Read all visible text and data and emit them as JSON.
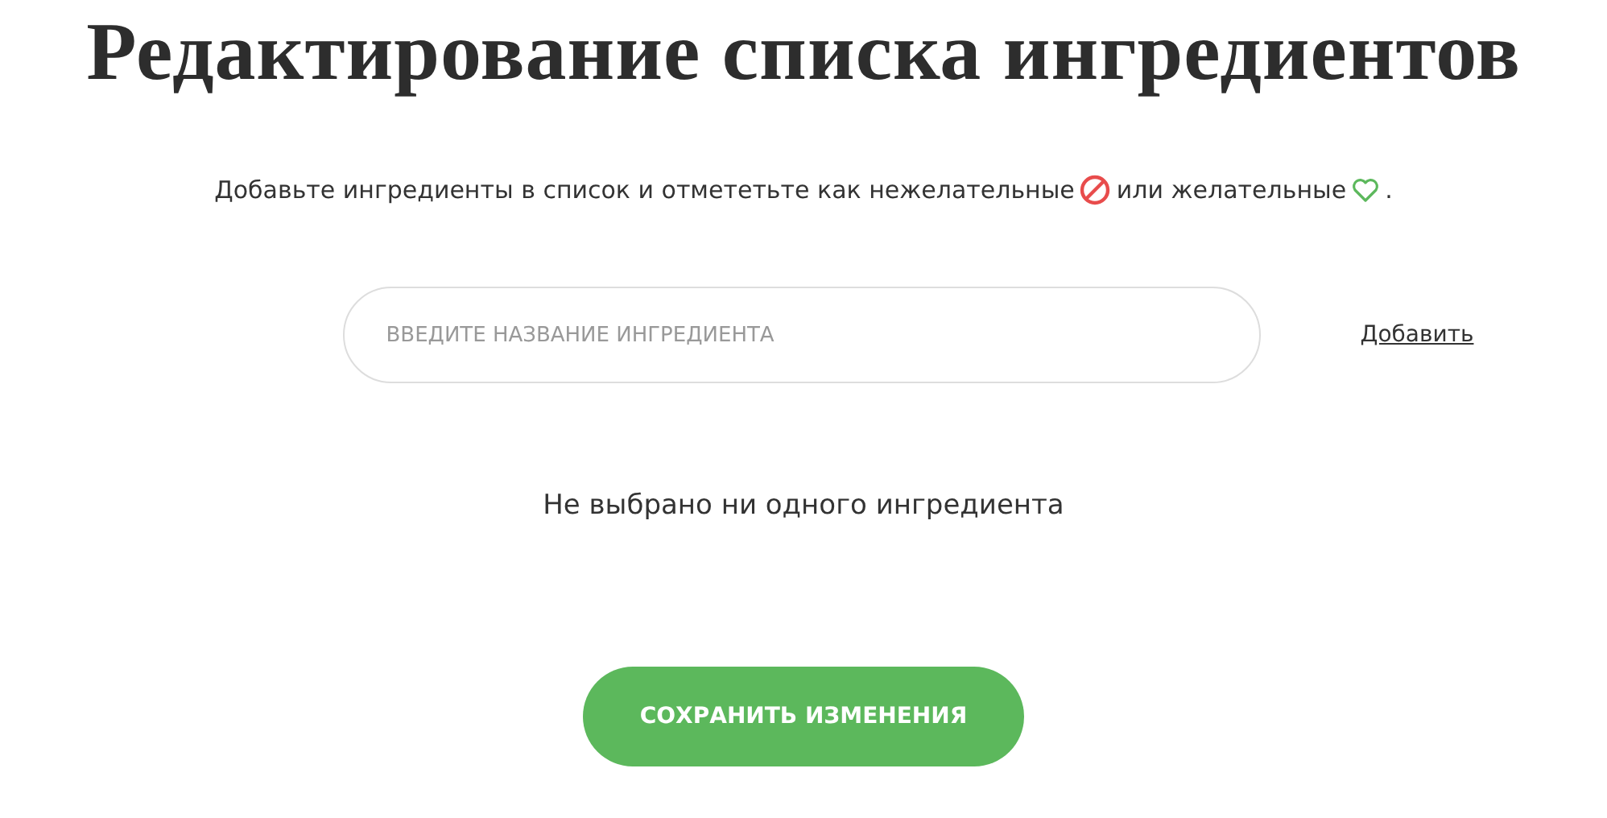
{
  "title": "Редактирование списка ингредиентов",
  "intro": {
    "part_1": "Добавьте ингредиенты в список и отмететьте как нежелательные",
    "part_2": "или желательные",
    "part_3": "."
  },
  "ingredient_field": {
    "placeholder": "ВВЕДИТЕ НАЗВАНИЕ ИНГРЕДИЕНТА"
  },
  "add_link": "Добавить",
  "empty_message": "Не выбрано ни одного ингредиента",
  "save_button": "СОХРАНИТЬ ИЗМЕНЕНИЯ"
}
